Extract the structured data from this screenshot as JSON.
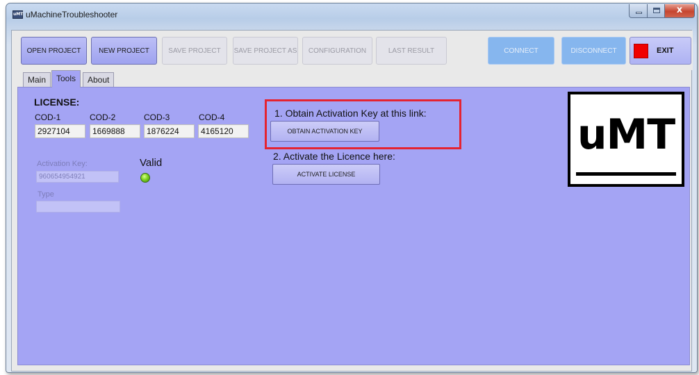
{
  "window": {
    "title": "uMachineTroubleshooter",
    "icon_label": "uMT",
    "close_glyph": "x"
  },
  "toolbar": {
    "open_project": "OPEN PROJECT",
    "new_project": "NEW PROJECT",
    "save_project": "SAVE PROJECT",
    "save_project_as": "SAVE PROJECT AS",
    "configuration": "CONFIGURATION",
    "last_result": "LAST RESULT",
    "connect": "CONNECT",
    "disconnect": "DISCONNECT",
    "exit": "EXIT"
  },
  "tabs": [
    {
      "label": "Main"
    },
    {
      "label": "Tools"
    },
    {
      "label": "About"
    }
  ],
  "license": {
    "title": "LICENSE:",
    "codes": [
      {
        "label": "COD-1",
        "value": "2927104"
      },
      {
        "label": "COD-2",
        "value": "1669888"
      },
      {
        "label": "COD-3",
        "value": "1876224"
      },
      {
        "label": "COD-4",
        "value": "4165120"
      }
    ],
    "activation_key_label": "Activation Key:",
    "activation_key_value": "960654954921",
    "status_label": "Valid",
    "type_label": "Type",
    "type_value": ""
  },
  "steps": {
    "step1": "1. Obtain Activation Key at this link:",
    "obtain_button": "OBTAIN ACTIVATION KEY",
    "step2": "2. Activate the Licence here:",
    "activate_button": "ACTIVATE LICENSE"
  },
  "logo": {
    "text": "uMT"
  },
  "colors": {
    "panel": "#a4a4f4",
    "highlight": "#e52330",
    "exit_indicator": "#f00000",
    "led_on": "#7ed321",
    "connect_blue": "#86b6ee"
  }
}
